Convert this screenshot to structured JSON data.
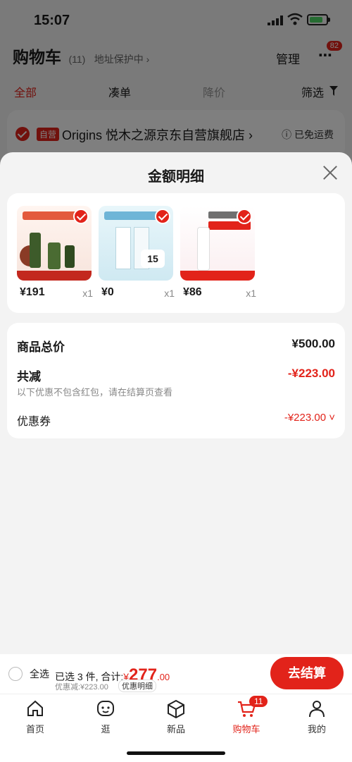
{
  "status_bar": {
    "time": "15:07"
  },
  "cart_header": {
    "title": "购物车",
    "count": "(11)",
    "address_protect": "地址保护中 ›",
    "manage": "管理",
    "more_badge": "82"
  },
  "filter_tabs": {
    "all": "全部",
    "coudan": "凑单",
    "price_drop": "降价",
    "filter": "筛选"
  },
  "store": {
    "self_tag": "自营",
    "name": "Origins 悦木之源京东自营旗舰店 ›",
    "free_shipping": "ⓘ 已免运费"
  },
  "sheet": {
    "title": "金额明细",
    "products": [
      {
        "price": "¥191",
        "qty": "x1",
        "badge_text": ""
      },
      {
        "price": "¥0",
        "qty": "x1",
        "badge_text": "15"
      },
      {
        "price": "¥86",
        "qty": "x1",
        "badge_text": ""
      }
    ],
    "totals": {
      "goods_total_label": "商品总价",
      "goods_total_value": "¥500.00",
      "total_discount_label": "共减",
      "total_discount_value": "-¥223.00",
      "note": "以下优惠不包含红包，请在结算页查看",
      "coupon_label": "优惠券",
      "coupon_value": "-¥223.00 ˅"
    }
  },
  "checkout": {
    "select_all": "全选",
    "selected_summary": "已选 3 件, 合计:",
    "currency": "¥",
    "amount_int": "277",
    "amount_dec": ".00",
    "discount_line": "优惠减:¥223.00",
    "detail_link": "优惠明细",
    "button": "去结算"
  },
  "tabbar": {
    "items": [
      {
        "label": "首页",
        "icon": "home-icon"
      },
      {
        "label": "逛",
        "icon": "face-icon"
      },
      {
        "label": "新品",
        "icon": "box-icon"
      },
      {
        "label": "购物车",
        "icon": "cart-icon"
      },
      {
        "label": "我的",
        "icon": "person-icon"
      }
    ],
    "cart_badge": "11"
  },
  "colors": {
    "accent": "#e2231a",
    "background": "#f3f3f3"
  }
}
